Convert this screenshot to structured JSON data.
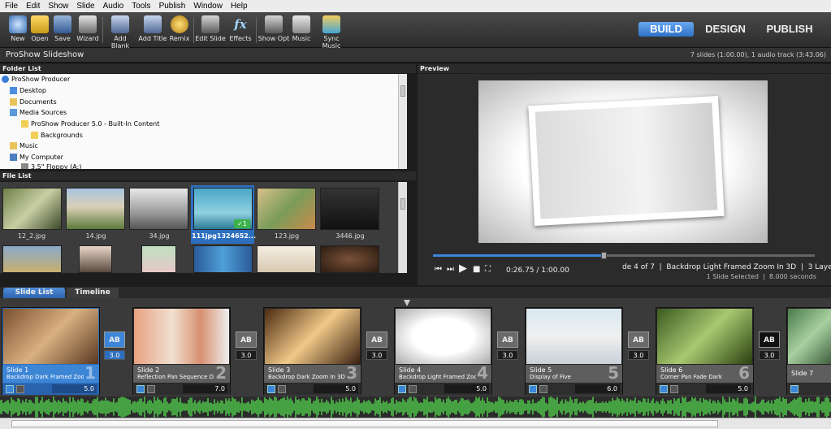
{
  "menu": [
    "File",
    "Edit",
    "Show",
    "Slide",
    "Audio",
    "Tools",
    "Publish",
    "Window",
    "Help"
  ],
  "toolbar": [
    {
      "label": "New",
      "icon": "new-show-icon"
    },
    {
      "label": "Open",
      "icon": "folder-open-icon"
    },
    {
      "label": "Save",
      "icon": "save-icon"
    },
    {
      "label": "Wizard",
      "icon": "wizard-icon"
    },
    {
      "label": "Add Blank",
      "icon": "add-blank-icon"
    },
    {
      "label": "Add Title",
      "icon": "add-title-icon"
    },
    {
      "label": "Remix",
      "icon": "remix-icon"
    },
    {
      "label": "Edit Slide",
      "icon": "edit-slide-icon"
    },
    {
      "label": "Effects",
      "icon": "effects-icon"
    },
    {
      "label": "Show Opt",
      "icon": "show-options-icon"
    },
    {
      "label": "Music",
      "icon": "music-icon"
    },
    {
      "label": "Sync Music",
      "icon": "sync-music-icon"
    }
  ],
  "modes": {
    "build": "BUILD",
    "design": "DESIGN",
    "publish": "PUBLISH"
  },
  "show_title": "ProShow Slideshow",
  "show_info": "7 slides (1:00.00), 1 audio track (3:43.06)",
  "folder_list": {
    "header": "Folder List",
    "items": [
      "ProShow Producer",
      "Desktop",
      "Documents",
      "Media Sources",
      "ProShow Producer 5.0 - Built-In Content",
      "Backgrounds",
      "Music",
      "My Computer",
      "3.5\" Floppy (A:)"
    ]
  },
  "file_list": {
    "header": "File List",
    "files": [
      "12_2.jpg",
      "14.jpg",
      "34.jpg",
      "111jpg1324652...",
      "123.jpg",
      "3446.jpg"
    ]
  },
  "preview": {
    "header": "Preview",
    "time": "0:26.75 / 1:00.00",
    "progress": 0.4458,
    "slide_info": "de 4 of 7  |  Backdrop Light Framed Zoom In 3D  |  3 Layers",
    "selection_info": "1 Slide Selected  |  8.000 seconds"
  },
  "tabs": {
    "slide_list": "Slide List",
    "timeline": "Timeline"
  },
  "slides": [
    {
      "name": "Slide 1",
      "desc": "Backdrop Dark Framed Zoo...",
      "num": "1",
      "dur": "5.0",
      "sel": true
    },
    {
      "name": "Slide 2",
      "desc": "Reflection Pan Sequence D...",
      "num": "2",
      "dur": "7.0",
      "sel": false
    },
    {
      "name": "Slide 3",
      "desc": "Backdrop Dark Zoom In 3D",
      "num": "3",
      "dur": "5.0",
      "sel": false
    },
    {
      "name": "Slide 4",
      "desc": "Backdrop Light Framed Zoo...",
      "num": "4",
      "dur": "5.0",
      "sel": false
    },
    {
      "name": "Slide 5",
      "desc": "Display of Five",
      "num": "5",
      "dur": "6.0",
      "sel": false
    },
    {
      "name": "Slide 6",
      "desc": "Corner Pan Fade Dark",
      "num": "6",
      "dur": "5.0",
      "sel": false
    },
    {
      "name": "Slide 7",
      "desc": "",
      "num": "",
      "dur": "",
      "sel": false
    }
  ],
  "transitions": [
    {
      "label": "AB",
      "time": "3.0",
      "sel": true
    },
    {
      "label": "AB",
      "time": "3.0",
      "sel": false
    },
    {
      "label": "AB",
      "time": "3.0",
      "sel": false
    },
    {
      "label": "AB",
      "time": "3.0",
      "sel": false
    },
    {
      "label": "AB",
      "time": "3.0",
      "sel": false
    },
    {
      "label": "AB",
      "time": "3.0",
      "sel": false
    }
  ]
}
